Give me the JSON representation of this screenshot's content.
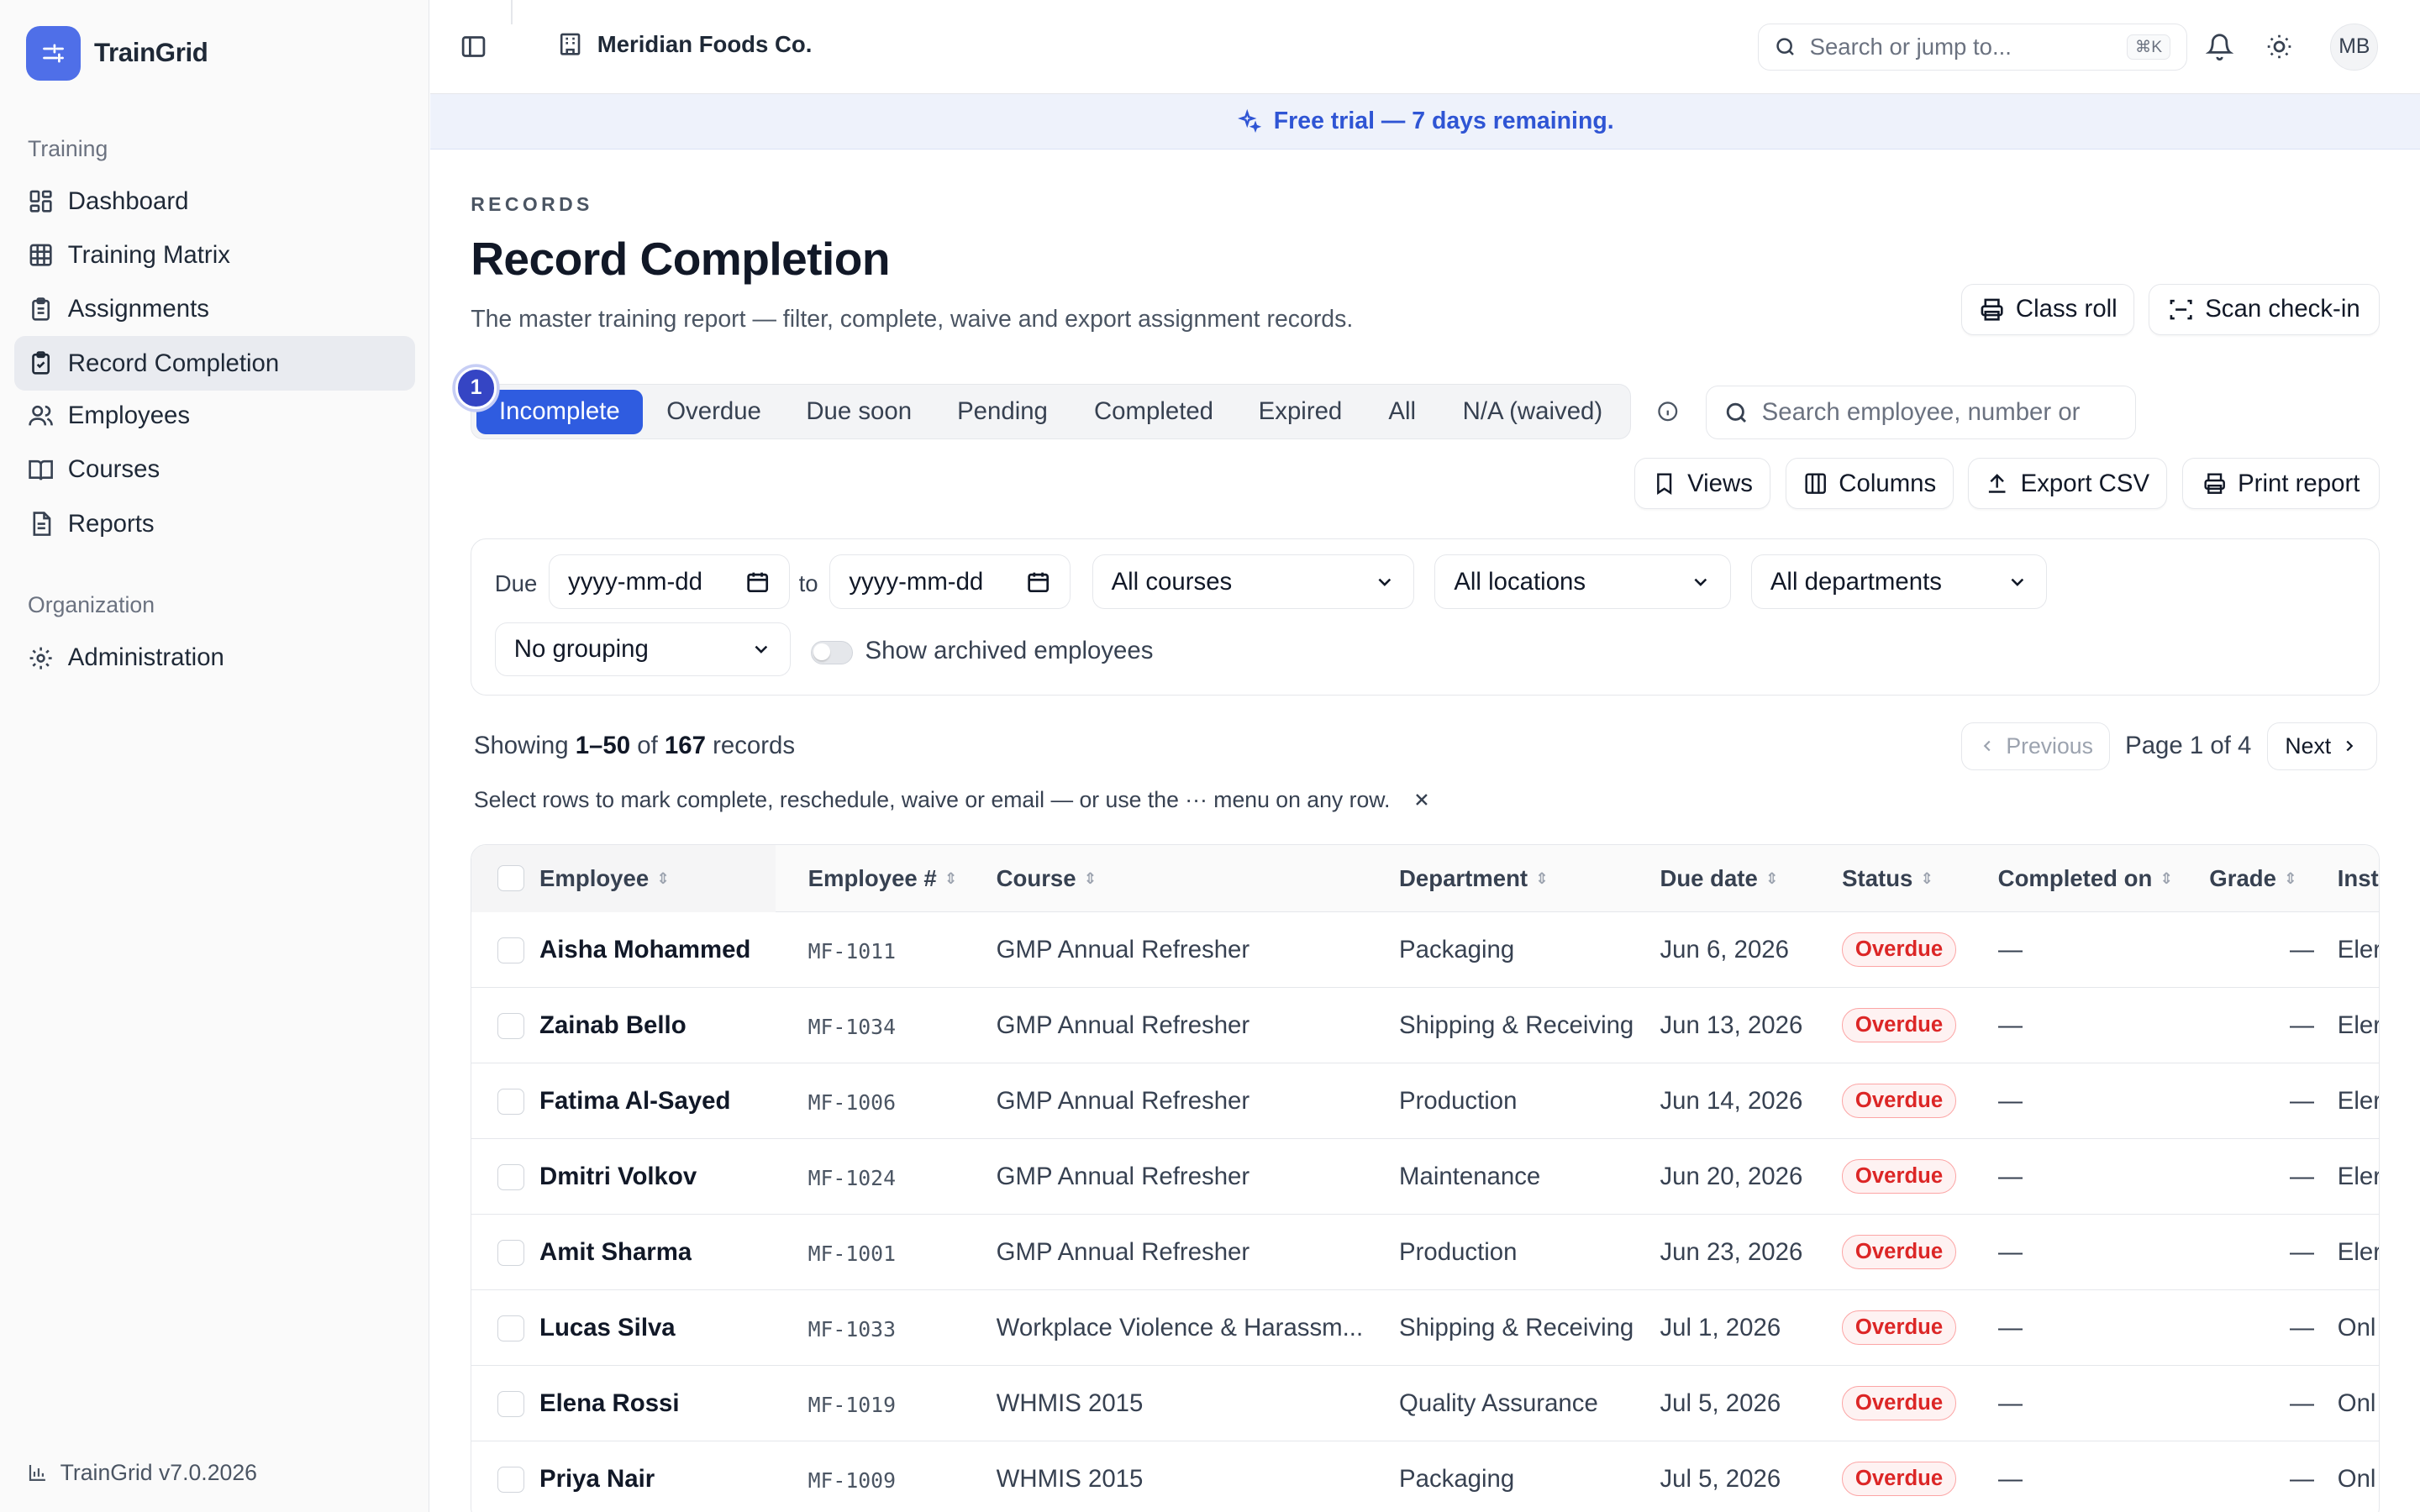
{
  "app": {
    "name": "TrainGrid",
    "version": "TrainGrid v7.0.2026"
  },
  "sidebar": {
    "groups": [
      {
        "label": "Training"
      },
      {
        "label": "Organization"
      }
    ],
    "items": [
      {
        "label": "Dashboard",
        "icon": "dashboard-icon"
      },
      {
        "label": "Training Matrix",
        "icon": "grid-icon"
      },
      {
        "label": "Assignments",
        "icon": "clipboard-icon"
      },
      {
        "label": "Record Completion",
        "icon": "clipboard-check-icon",
        "active": true
      },
      {
        "label": "Employees",
        "icon": "users-icon"
      },
      {
        "label": "Courses",
        "icon": "book-icon"
      },
      {
        "label": "Reports",
        "icon": "file-icon"
      },
      {
        "label": "Administration",
        "icon": "gear-icon"
      }
    ]
  },
  "topbar": {
    "org": "Meridian Foods Co.",
    "search_placeholder": "Search or jump to...",
    "shortcut": "⌘K",
    "avatar": "MB"
  },
  "banner": {
    "text": "Free trial — 7 days remaining."
  },
  "page": {
    "eyebrow": "RECORDS",
    "title": "Record Completion",
    "subtitle": "The master training report — filter, complete, waive and export assignment records."
  },
  "actions": {
    "class_roll": "Class roll",
    "scan_checkin": "Scan check-in",
    "views": "Views",
    "columns": "Columns",
    "export_csv": "Export CSV",
    "print_report": "Print report"
  },
  "tabs": {
    "step": "1",
    "items": [
      "Incomplete",
      "Overdue",
      "Due soon",
      "Pending",
      "Completed",
      "Expired",
      "All",
      "N/A (waived)"
    ]
  },
  "search": {
    "placeholder": "Search employee, number or"
  },
  "filters": {
    "due_label": "Due",
    "date_placeholder": "yyyy-mm-dd",
    "to_label": "to",
    "courses": "All courses",
    "locations": "All locations",
    "departments": "All departments",
    "grouping": "No grouping",
    "archived_label": "Show archived employees",
    "archived_on": false
  },
  "results": {
    "prefix": "Showing",
    "range": "1–50",
    "of": "of",
    "total": "167",
    "suffix": "records"
  },
  "pager": {
    "previous": "Previous",
    "label": "Page 1 of 4",
    "next": "Next"
  },
  "hint": "Select rows to mark complete, reschedule, waive or email — or use the ··· menu on any row.",
  "table": {
    "columns": [
      "Employee",
      "Employee #",
      "Course",
      "Department",
      "Due date",
      "Status",
      "Completed on",
      "Grade",
      "Inst"
    ],
    "rows": [
      {
        "name": "Aisha Mohammed",
        "num": "MF-1011",
        "course": "GMP Annual Refresher",
        "dept": "Packaging",
        "due": "Jun 6, 2026",
        "status": "Overdue",
        "completed": "—",
        "grade": "—",
        "inst": "Eler"
      },
      {
        "name": "Zainab Bello",
        "num": "MF-1034",
        "course": "GMP Annual Refresher",
        "dept": "Shipping & Receiving",
        "due": "Jun 13, 2026",
        "status": "Overdue",
        "completed": "—",
        "grade": "—",
        "inst": "Eler"
      },
      {
        "name": "Fatima Al-Sayed",
        "num": "MF-1006",
        "course": "GMP Annual Refresher",
        "dept": "Production",
        "due": "Jun 14, 2026",
        "status": "Overdue",
        "completed": "—",
        "grade": "—",
        "inst": "Eler"
      },
      {
        "name": "Dmitri Volkov",
        "num": "MF-1024",
        "course": "GMP Annual Refresher",
        "dept": "Maintenance",
        "due": "Jun 20, 2026",
        "status": "Overdue",
        "completed": "—",
        "grade": "—",
        "inst": "Eler"
      },
      {
        "name": "Amit Sharma",
        "num": "MF-1001",
        "course": "GMP Annual Refresher",
        "dept": "Production",
        "due": "Jun 23, 2026",
        "status": "Overdue",
        "completed": "—",
        "grade": "—",
        "inst": "Eler"
      },
      {
        "name": "Lucas Silva",
        "num": "MF-1033",
        "course": "Workplace Violence & Harassm...",
        "dept": "Shipping & Receiving",
        "due": "Jul 1, 2026",
        "status": "Overdue",
        "completed": "—",
        "grade": "—",
        "inst": "Onl"
      },
      {
        "name": "Elena Rossi",
        "num": "MF-1019",
        "course": "WHMIS 2015",
        "dept": "Quality Assurance",
        "due": "Jul 5, 2026",
        "status": "Overdue",
        "completed": "—",
        "grade": "—",
        "inst": "Onl"
      },
      {
        "name": "Priya Nair",
        "num": "MF-1009",
        "course": "WHMIS 2015",
        "dept": "Packaging",
        "due": "Jul 5, 2026",
        "status": "Overdue",
        "completed": "—",
        "grade": "—",
        "inst": "Onl"
      }
    ]
  },
  "colors": {
    "accent": "#2f5ce0",
    "brand": "#4f6fe8",
    "overdue": "#dc2626"
  }
}
